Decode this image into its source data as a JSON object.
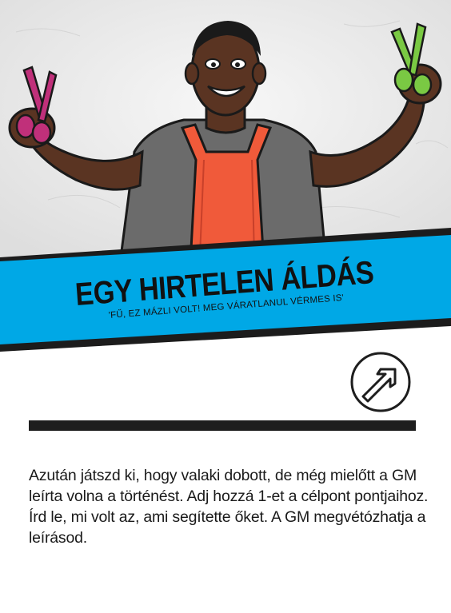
{
  "card": {
    "title": "EGY HIRTELEN ÁLDÁS",
    "subtitle": "'FŰ, EZ MÁZLI VOLT! MEG VÁRATLANUL VÉRMES IS'",
    "icon": "arrow-up-right-circle-icon",
    "body": "Azután játszd ki, hogy valaki dobott, de még mielőtt a GM leírta volna a történést. Adj hozzá 1-et a célpont pontjaihoz. Írd le, mi volt az, ami segítette őket. A GM megvétózhatja a leírásod."
  },
  "colors": {
    "banner_blue": "#00a8e6",
    "banner_edge": "#1c1c1c",
    "apron": "#f05a3a",
    "shirt": "#6b6b6b",
    "skin": "#5a3422",
    "scissors_left": "#c0307a",
    "scissors_right": "#7ac943"
  }
}
